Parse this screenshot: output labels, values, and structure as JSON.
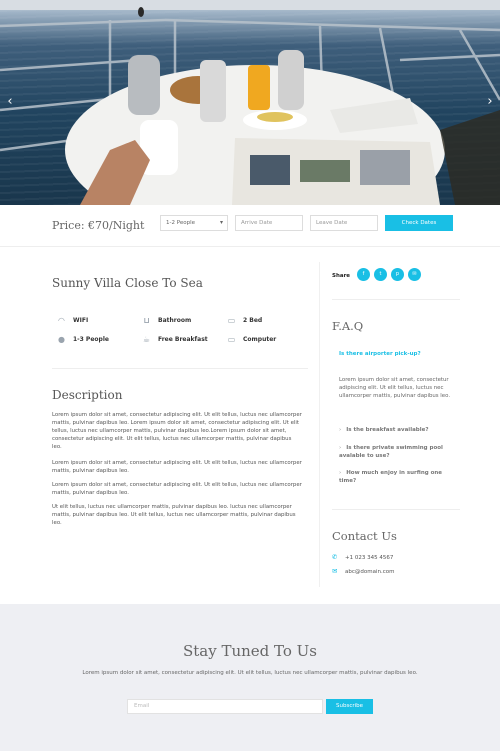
{
  "hero": {
    "prev_arrow": "‹",
    "next_arrow": "›"
  },
  "booking": {
    "price": "Price: €70/Night",
    "people_select": "1-2 People",
    "arrive_placeholder": "Arrive Date",
    "leave_placeholder": "Leave Date",
    "check_button": "Check Dates"
  },
  "room": {
    "title": "Sunny Villa Close To Sea",
    "amenities": [
      {
        "label": "WIFI",
        "icon": "wifi-icon"
      },
      {
        "label": "Bathroom",
        "icon": "bathtub-icon"
      },
      {
        "label": "2 Bed",
        "icon": "bed-icon"
      },
      {
        "label": "1-3 People",
        "icon": "people-icon"
      },
      {
        "label": "Free Breakfast",
        "icon": "coffee-icon"
      },
      {
        "label": "Computer",
        "icon": "monitor-icon"
      }
    ]
  },
  "description": {
    "title": "Description",
    "paragraphs": [
      "Lorem ipsum dolor sit amet, consectetur adipiscing elit. Ut elit tellus, luctus nec ullamcorper mattis, pulvinar dapibus leo. Lorem ipsum dolor sit amet, consectetur adipiscing elit. Ut elit tellus, luctus nec ullamcorper mattis, pulvinar dapibus leo.Lorem ipsum dolor sit amet, consectetur adipiscing elit. Ut elit tellus, luctus nec ullamcorper mattis, pulvinar dapibus leo.",
      "Lorem ipsum dolor sit amet, consectetur adipiscing elit. Ut elit tellus, luctus nec ullamcorper mattis, pulvinar dapibus leo.",
      "Lorem ipsum dolor sit amet, consectetur adipiscing elit. Ut elit tellus, luctus nec ullamcorper mattis, pulvinar dapibus leo.",
      "Ut elit tellus, luctus nec ullamcorper mattis, pulvinar dapibus leo.  luctus nec ullamcorper mattis, pulvinar dapibus leo. Ut elit tellus, luctus nec ullamcorper mattis, pulvinar dapibus leo."
    ]
  },
  "sidebar": {
    "share_label": "Share",
    "social": [
      {
        "icon": "facebook-icon",
        "glyph": "f"
      },
      {
        "icon": "twitter-icon",
        "glyph": "t"
      },
      {
        "icon": "pinterest-icon",
        "glyph": "p"
      },
      {
        "icon": "email-icon",
        "glyph": "✉"
      }
    ],
    "faq_title": "F.A.Q",
    "faq_open_question": "Is there airporter pick-up?",
    "faq_open_answer": "Lorem ipsum dolor sit amet, consectetur adipiscing elit. Ut elit tellus, luctus nec ullamcorper mattis, pulvinar dapibus leo.",
    "faq_questions": [
      "Is the breakfast available?",
      "Is there private swimming pool avalable to use?",
      "How much enjoy in surfing one time?"
    ],
    "contact_title": "Contact Us",
    "phone": "+1 023 345 4567",
    "email": "abc@domain.com"
  },
  "newsletter": {
    "title": "Stay Tuned To Us",
    "text": "Lorem ipsum dolor sit amet, consectetur adipiscing elit. Ut elit tellus, luctus nec ullamcorper mattis, pulvinar dapibus leo.",
    "email_placeholder": "Email",
    "subscribe_button": "Subscribe"
  },
  "colors": {
    "accent": "#19bfe5",
    "footer_bg": "#eeeff3"
  }
}
